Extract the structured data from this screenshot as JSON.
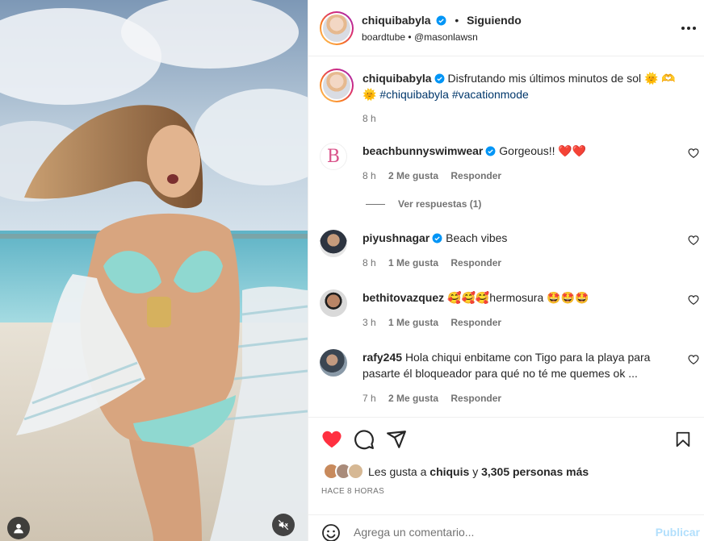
{
  "post": {
    "author": "chiquibabyla",
    "follow_state": "Siguiendo",
    "separator": "•",
    "audio": "boardtube",
    "collab_separator": "•",
    "collab": "@masonlawsn"
  },
  "caption": {
    "username": "chiquibabyla",
    "text_prefix": "Disfrutando mis últimos minutos de sol",
    "emoji_1": "🌞",
    "emoji_2": "🫶",
    "emoji_3": "🌞",
    "hashtags": "#chiquibabyla #vacationmode",
    "time": "8 h"
  },
  "comments": [
    {
      "username": "beachbunnyswimwear",
      "verified": true,
      "text": "Gorgeous!! ❤️❤️",
      "time": "8 h",
      "likes": "2 Me gusta",
      "reply": "Responder"
    },
    {
      "username": "piyushnagar",
      "verified": true,
      "text": "Beach vibes",
      "time": "8 h",
      "likes": "1 Me gusta",
      "reply": "Responder"
    },
    {
      "username": "bethitovazquez",
      "verified": false,
      "text": "🥰🥰🥰hermosura 🤩🤩🤩",
      "time": "3 h",
      "likes": "1 Me gusta",
      "reply": "Responder"
    },
    {
      "username": "rafy245",
      "verified": false,
      "text": "Hola chiqui enbitame con Tigo para la playa para pasarte él bloqueador para qué no té me quemes ok ...",
      "time": "7 h",
      "likes": "2 Me gusta",
      "reply": "Responder"
    }
  ],
  "view_replies": "Ver respuestas (1)",
  "likes_summary": {
    "prefix": "Les gusta a",
    "user": "chiquis",
    "middle": "y",
    "count": "3,305 personas más"
  },
  "posted_ago": "HACE 8 HORAS",
  "add_comment": {
    "placeholder": "Agrega un comentario...",
    "post_label": "Publicar"
  },
  "colors": {
    "like_red": "#ff3040",
    "verified_blue": "#0095f6",
    "link_blue": "#00376b",
    "post_disabled": "#b2dffc",
    "muted_text": "#737373"
  },
  "icons": [
    "user-tag-icon",
    "muted-audio-icon",
    "more-options-icon",
    "heart-filled-icon",
    "comment-icon",
    "share-icon",
    "bookmark-icon",
    "emoji-icon",
    "heart-outline-icon",
    "verified-badge-icon"
  ]
}
